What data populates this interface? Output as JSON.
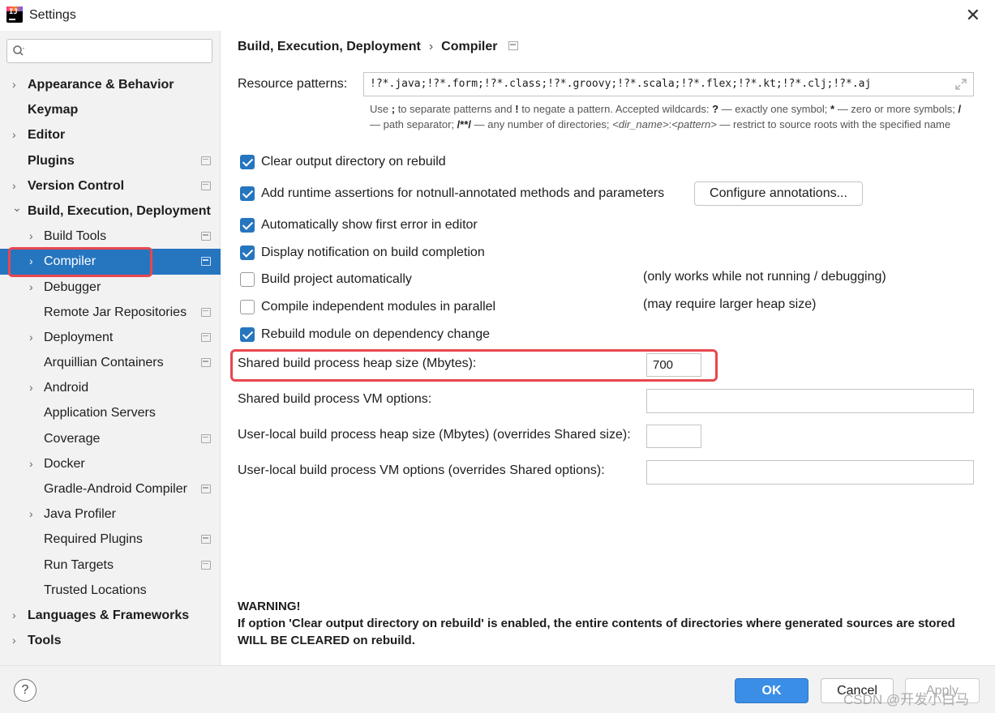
{
  "window": {
    "title": "Settings"
  },
  "search": {
    "placeholder": ""
  },
  "sidebar": {
    "items": [
      {
        "label": "Appearance & Behavior",
        "level": 0,
        "chevron": "›",
        "proj": false
      },
      {
        "label": "Keymap",
        "level": 0,
        "chevron": "",
        "proj": false
      },
      {
        "label": "Editor",
        "level": 0,
        "chevron": "›",
        "proj": false
      },
      {
        "label": "Plugins",
        "level": 0,
        "chevron": "",
        "proj": true
      },
      {
        "label": "Version Control",
        "level": 0,
        "chevron": "›",
        "proj": true
      },
      {
        "label": "Build, Execution, Deployment",
        "level": 0,
        "chevron": "⌄",
        "proj": false
      },
      {
        "label": "Build Tools",
        "level": 1,
        "chevron": "›",
        "proj": true
      },
      {
        "label": "Compiler",
        "level": 1,
        "chevron": "›",
        "proj": true,
        "selected": true
      },
      {
        "label": "Debugger",
        "level": 1,
        "chevron": "›",
        "proj": false
      },
      {
        "label": "Remote Jar Repositories",
        "level": 1,
        "chevron": "",
        "proj": true
      },
      {
        "label": "Deployment",
        "level": 1,
        "chevron": "›",
        "proj": true
      },
      {
        "label": "Arquillian Containers",
        "level": 1,
        "chevron": "",
        "proj": true
      },
      {
        "label": "Android",
        "level": 1,
        "chevron": "›",
        "proj": false
      },
      {
        "label": "Application Servers",
        "level": 1,
        "chevron": "",
        "proj": false
      },
      {
        "label": "Coverage",
        "level": 1,
        "chevron": "",
        "proj": true
      },
      {
        "label": "Docker",
        "level": 1,
        "chevron": "›",
        "proj": false
      },
      {
        "label": "Gradle-Android Compiler",
        "level": 1,
        "chevron": "",
        "proj": true
      },
      {
        "label": "Java Profiler",
        "level": 1,
        "chevron": "›",
        "proj": false
      },
      {
        "label": "Required Plugins",
        "level": 1,
        "chevron": "",
        "proj": true
      },
      {
        "label": "Run Targets",
        "level": 1,
        "chevron": "",
        "proj": true
      },
      {
        "label": "Trusted Locations",
        "level": 1,
        "chevron": "",
        "proj": false
      },
      {
        "label": "Languages & Frameworks",
        "level": 0,
        "chevron": "›",
        "proj": false
      },
      {
        "label": "Tools",
        "level": 0,
        "chevron": "›",
        "proj": false
      }
    ]
  },
  "breadcrumb": {
    "parent": "Build, Execution, Deployment",
    "separator": "›",
    "current": "Compiler"
  },
  "resource_patterns": {
    "label": "Resource patterns:",
    "value": "!?*.java;!?*.form;!?*.class;!?*.groovy;!?*.scala;!?*.flex;!?*.kt;!?*.clj;!?*.aj",
    "hint_parts": {
      "p1": "Use ",
      "b1": ";",
      "p2": " to separate patterns and ",
      "b2": "!",
      "p3": " to negate a pattern. Accepted wildcards: ",
      "b3": "?",
      "p4": " — exactly one symbol; ",
      "b4": "*",
      "p5": " — zero or more symbols; ",
      "b5": "/",
      "p6": " — path separator; ",
      "b6": "/**/",
      "p7": " — any number of directories; ",
      "i1": "<dir_name>",
      "p8": ":",
      "i2": "<pattern>",
      "p9": " — restrict to source roots with the specified name"
    }
  },
  "checkboxes": [
    {
      "label": "Clear output directory on rebuild",
      "checked": true
    },
    {
      "label": "Add runtime assertions for notnull-annotated methods and parameters",
      "checked": true
    },
    {
      "label": "Automatically show first error in editor",
      "checked": true
    },
    {
      "label": "Display notification on build completion",
      "checked": true
    },
    {
      "label": "Build project automatically",
      "checked": false,
      "note": "(only works while not running / debugging)"
    },
    {
      "label": "Compile independent modules in parallel",
      "checked": false,
      "note": "(may require larger heap size)"
    },
    {
      "label": "Rebuild module on dependency change",
      "checked": true
    }
  ],
  "configure_button": "Configure annotations...",
  "fields": {
    "shared_heap_label": "Shared build process heap size (Mbytes):",
    "shared_heap_value": "700",
    "shared_vm_label": "Shared build process VM options:",
    "shared_vm_value": "",
    "user_heap_label": "User-local build process heap size (Mbytes) (overrides Shared size):",
    "user_heap_value": "",
    "user_vm_label": "User-local build process VM options (overrides Shared options):",
    "user_vm_value": ""
  },
  "warning": {
    "title": "WARNING!",
    "text": "If option 'Clear output directory on rebuild' is enabled, the entire contents of directories where generated sources are stored WILL BE CLEARED on rebuild."
  },
  "footer": {
    "help": "?",
    "ok": "OK",
    "cancel": "Cancel",
    "apply": "Apply",
    "watermark": "CSDN @开发小白马"
  },
  "colors": {
    "accent": "#2675bf",
    "highlight": "#e8474f",
    "ok_button": "#3a8ee6"
  }
}
